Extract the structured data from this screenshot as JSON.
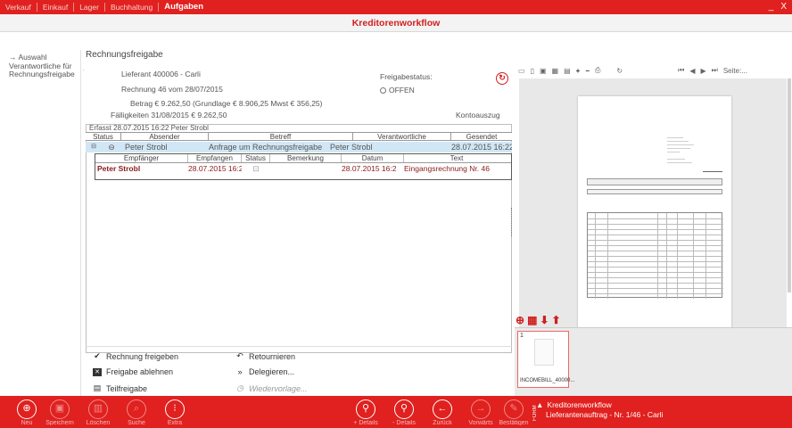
{
  "menu": {
    "items": [
      "Verkauf",
      "Einkauf",
      "Lager",
      "Buchhaltung"
    ],
    "active": "Aufgaben",
    "window_controls": [
      "_",
      "X"
    ]
  },
  "header": {
    "title": "Kreditorenworkflow"
  },
  "leftnav": {
    "back_label": "Auswahl Verantwortliche für Rechnungsfreigabe"
  },
  "main": {
    "section_title": "Rechnungsfreigabe",
    "lieferant": "Lieferant 400006 - Carli",
    "rechnung": "Rechnung 46 vom 28/07/2015",
    "betrag": "Betrag € 9.262,50  (Grundlage € 8.906,25  Mwst € 356,25)",
    "faelligkeiten": "Fälligkeiten 31/08/2015 € 9.262,50",
    "freigabestatus_label": "Freigabestatus:",
    "status_value": "OFFEN",
    "kontoauszug": "Kontoauszug",
    "erfasst": "Erfasst 28.07.2015 16:22  Peter Strobl"
  },
  "table": {
    "headers": [
      "Status",
      "Absender",
      "Betreff",
      "Verantwortliche",
      "Gesendet"
    ],
    "row": {
      "absender": "Peter Strobl",
      "betreff": "Anfrage um Rechnungsfreigabe",
      "verantwortliche": "Peter Strobl",
      "gesendet": "28.07.2015 16:22"
    },
    "inner_headers": [
      "Empfänger",
      "Empfangen",
      "Status",
      "Bemerkung",
      "Datum",
      "Text"
    ],
    "inner_row": {
      "empfaenger": "Peter Strobl",
      "empfangen": "28.07.2015 16:2",
      "bemerkung": "",
      "datum": "28.07.2015 16:2",
      "text": "Eingangsrechnung Nr. 46"
    }
  },
  "actions": {
    "freigeben": "Rechnung freigeben",
    "ablehnen": "Freigabe ablehnen",
    "teilfreigabe": "Teilfreigabe",
    "retournieren": "Retournieren",
    "delegieren": "Delegieren...",
    "wiedervorlage": "Wiedervorlage..."
  },
  "preview": {
    "page_label": "Seite:...",
    "thumb_number": "1",
    "thumb_caption": "INCOMEBILL_40000..."
  },
  "bottombar": {
    "buttons": [
      "Neu",
      "Speichern",
      "Löschen",
      "Suche",
      "Extra",
      "+ Details",
      "- Details",
      "Zurück",
      "Vorwärts",
      "Bestätigen"
    ],
    "side_tag": "FORM",
    "notification_title": "Kreditorenworkflow",
    "notification_sub": "Lieferantenauftrag - Nr. 1/46 - Carli"
  },
  "colors": {
    "accent": "#e0211f",
    "title": "#d01f1e",
    "row_highlight": "#d1e7f5"
  }
}
